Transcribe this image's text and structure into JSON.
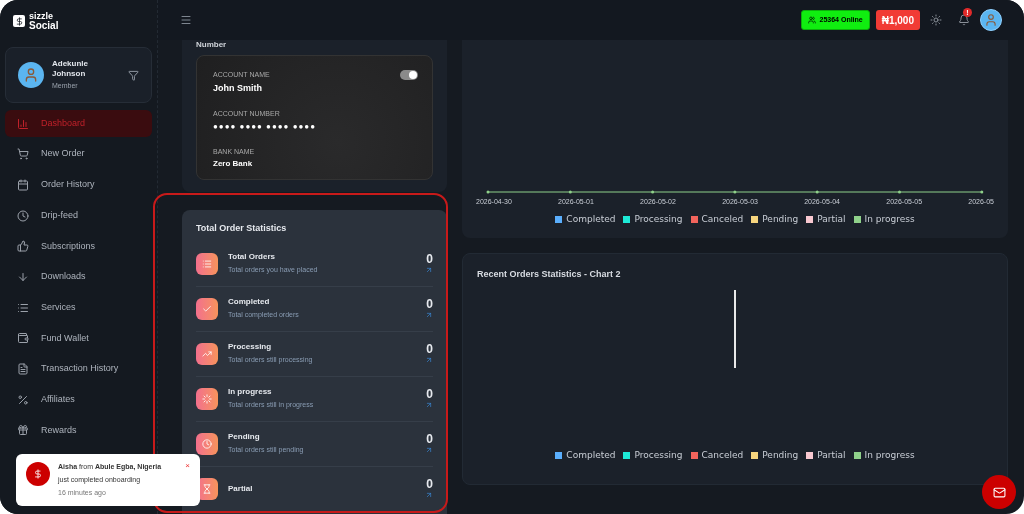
{
  "brand": {
    "line1": "sizzle",
    "line2": "Social"
  },
  "profile": {
    "name": "Adekunle Johnson",
    "role": "Member"
  },
  "sidebar": {
    "items": [
      {
        "label": "Dashboard",
        "selected": true
      },
      {
        "label": "New Order",
        "selected": false
      },
      {
        "label": "Order History",
        "selected": false
      },
      {
        "label": "Drip-feed",
        "selected": false
      },
      {
        "label": "Subscriptions",
        "selected": false
      },
      {
        "label": "Downloads",
        "selected": false
      },
      {
        "label": "Services",
        "selected": false
      },
      {
        "label": "Fund Wallet",
        "selected": false
      },
      {
        "label": "Transaction History",
        "selected": false
      },
      {
        "label": "Affiliates",
        "selected": false
      },
      {
        "label": "Rewards",
        "selected": false
      }
    ]
  },
  "header": {
    "online": "25364 Online",
    "balance": "₦1,000",
    "notification_badge": "!"
  },
  "bank_panel": {
    "heading": "Number",
    "account_name_label": "ACCOUNT NAME",
    "account_name": "John Smith",
    "account_number_label": "ACCOUNT NUMBER",
    "account_number": "●●●● ●●●● ●●●● ●●●●",
    "bank_name_label": "BANK NAME",
    "bank_name": "Zero Bank",
    "toggle_on": true
  },
  "order_stats": {
    "title": "Total Order Statistics",
    "rows": [
      {
        "title": "Total Orders",
        "subtitle": "Total orders you have placed",
        "value": "0"
      },
      {
        "title": "Completed",
        "subtitle": "Total completed orders",
        "value": "0"
      },
      {
        "title": "Processing",
        "subtitle": "Total orders still processing",
        "value": "0"
      },
      {
        "title": "In progress",
        "subtitle": "Total orders still in progress",
        "value": "0"
      },
      {
        "title": "Pending",
        "subtitle": "Total orders still pending",
        "value": "0"
      },
      {
        "title": "Partial",
        "value": "0"
      }
    ]
  },
  "chart_1": {
    "x_labels": [
      "2026-04-30",
      "2026-05-01",
      "2026-05-02",
      "2026-05-03",
      "2026-05-04",
      "2026-05-05",
      "2026-05"
    ],
    "legend": [
      {
        "label": "Completed",
        "color": "#5aaefc"
      },
      {
        "label": "Processing",
        "color": "#1de9d6"
      },
      {
        "label": "Canceled",
        "color": "#f2645c"
      },
      {
        "label": "Pending",
        "color": "#f7d57e"
      },
      {
        "label": "Partial",
        "color": "#f8c8d0"
      },
      {
        "label": "In progress",
        "color": "#8fd18a"
      }
    ]
  },
  "chart_2": {
    "title": "Recent Orders Statistics - Chart 2",
    "legend": [
      {
        "label": "Completed",
        "color": "#5aaefc"
      },
      {
        "label": "Processing",
        "color": "#1de9d6"
      },
      {
        "label": "Canceled",
        "color": "#f2645c"
      },
      {
        "label": "Pending",
        "color": "#f7d57e"
      },
      {
        "label": "Partial",
        "color": "#f8c8d0"
      },
      {
        "label": "In progress",
        "color": "#8fd18a"
      }
    ]
  },
  "toast": {
    "message": "**Aisha** from **Abule Egba, Nigeria**",
    "detail": "just completed onboarding",
    "time": "16 minutes ago",
    "close": "×"
  }
}
